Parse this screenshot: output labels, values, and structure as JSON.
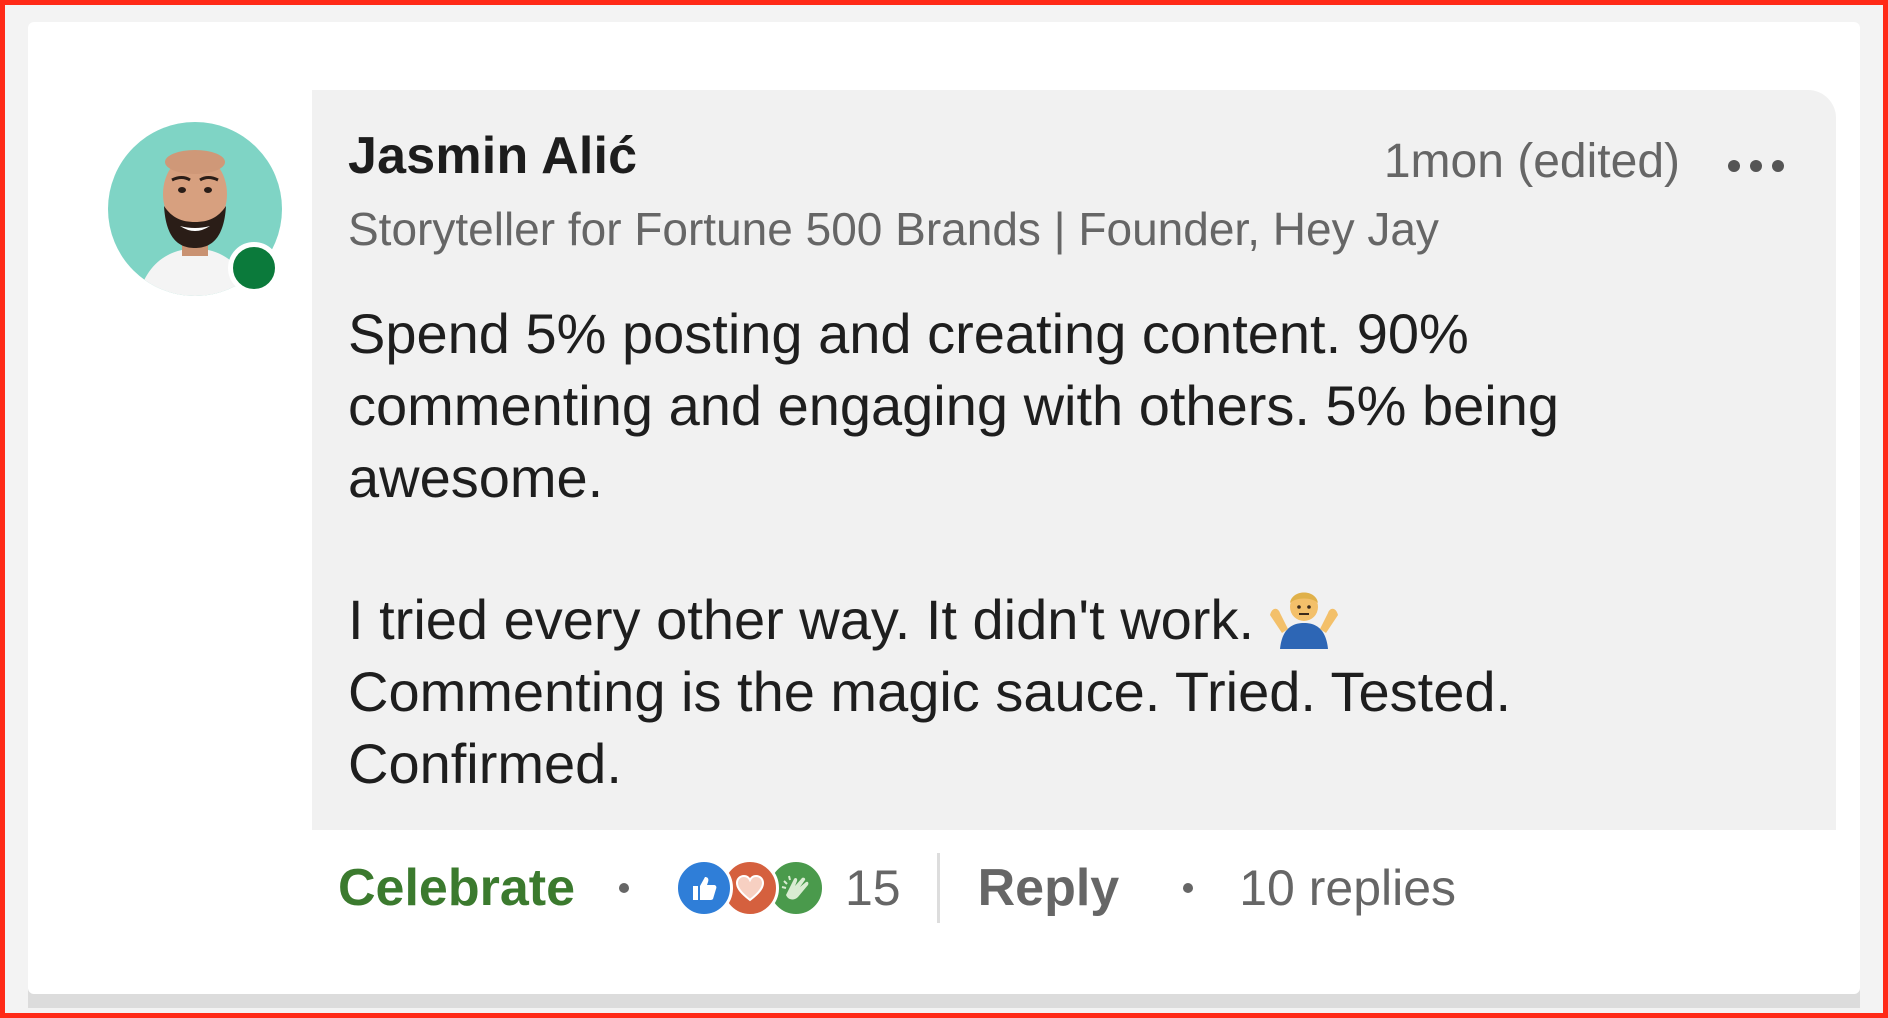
{
  "comment": {
    "author": "Jasmin Alić",
    "headline": "Storyteller for Fortune 500 Brands | Founder, Hey Jay",
    "timestamp": "1mon (edited)",
    "paragraphs": [
      "Spend 5% posting and creating content. 90% commenting and engaging with others. 5% being awesome.",
      "I tried every other way. It didn't work.",
      "Commenting is the magic sauce. Tried. Tested. Confirmed."
    ],
    "emoji_icon": "person-shrugging-icon"
  },
  "actions": {
    "reaction_label": "Celebrate",
    "reaction_icons": [
      "like-icon",
      "love-icon",
      "celebrate-icon"
    ],
    "reaction_count": "15",
    "reply_label": "Reply",
    "replies_text": "10 replies"
  },
  "colors": {
    "frame_border": "#ff2a17",
    "bubble_bg": "#f1f1f1",
    "celebrate_green": "#3b7a2e",
    "online_status": "#0b7a3b",
    "like_blue": "#2f7ed8",
    "love_orange": "#d5603e",
    "celebrate_badge": "#4a9a4c"
  }
}
